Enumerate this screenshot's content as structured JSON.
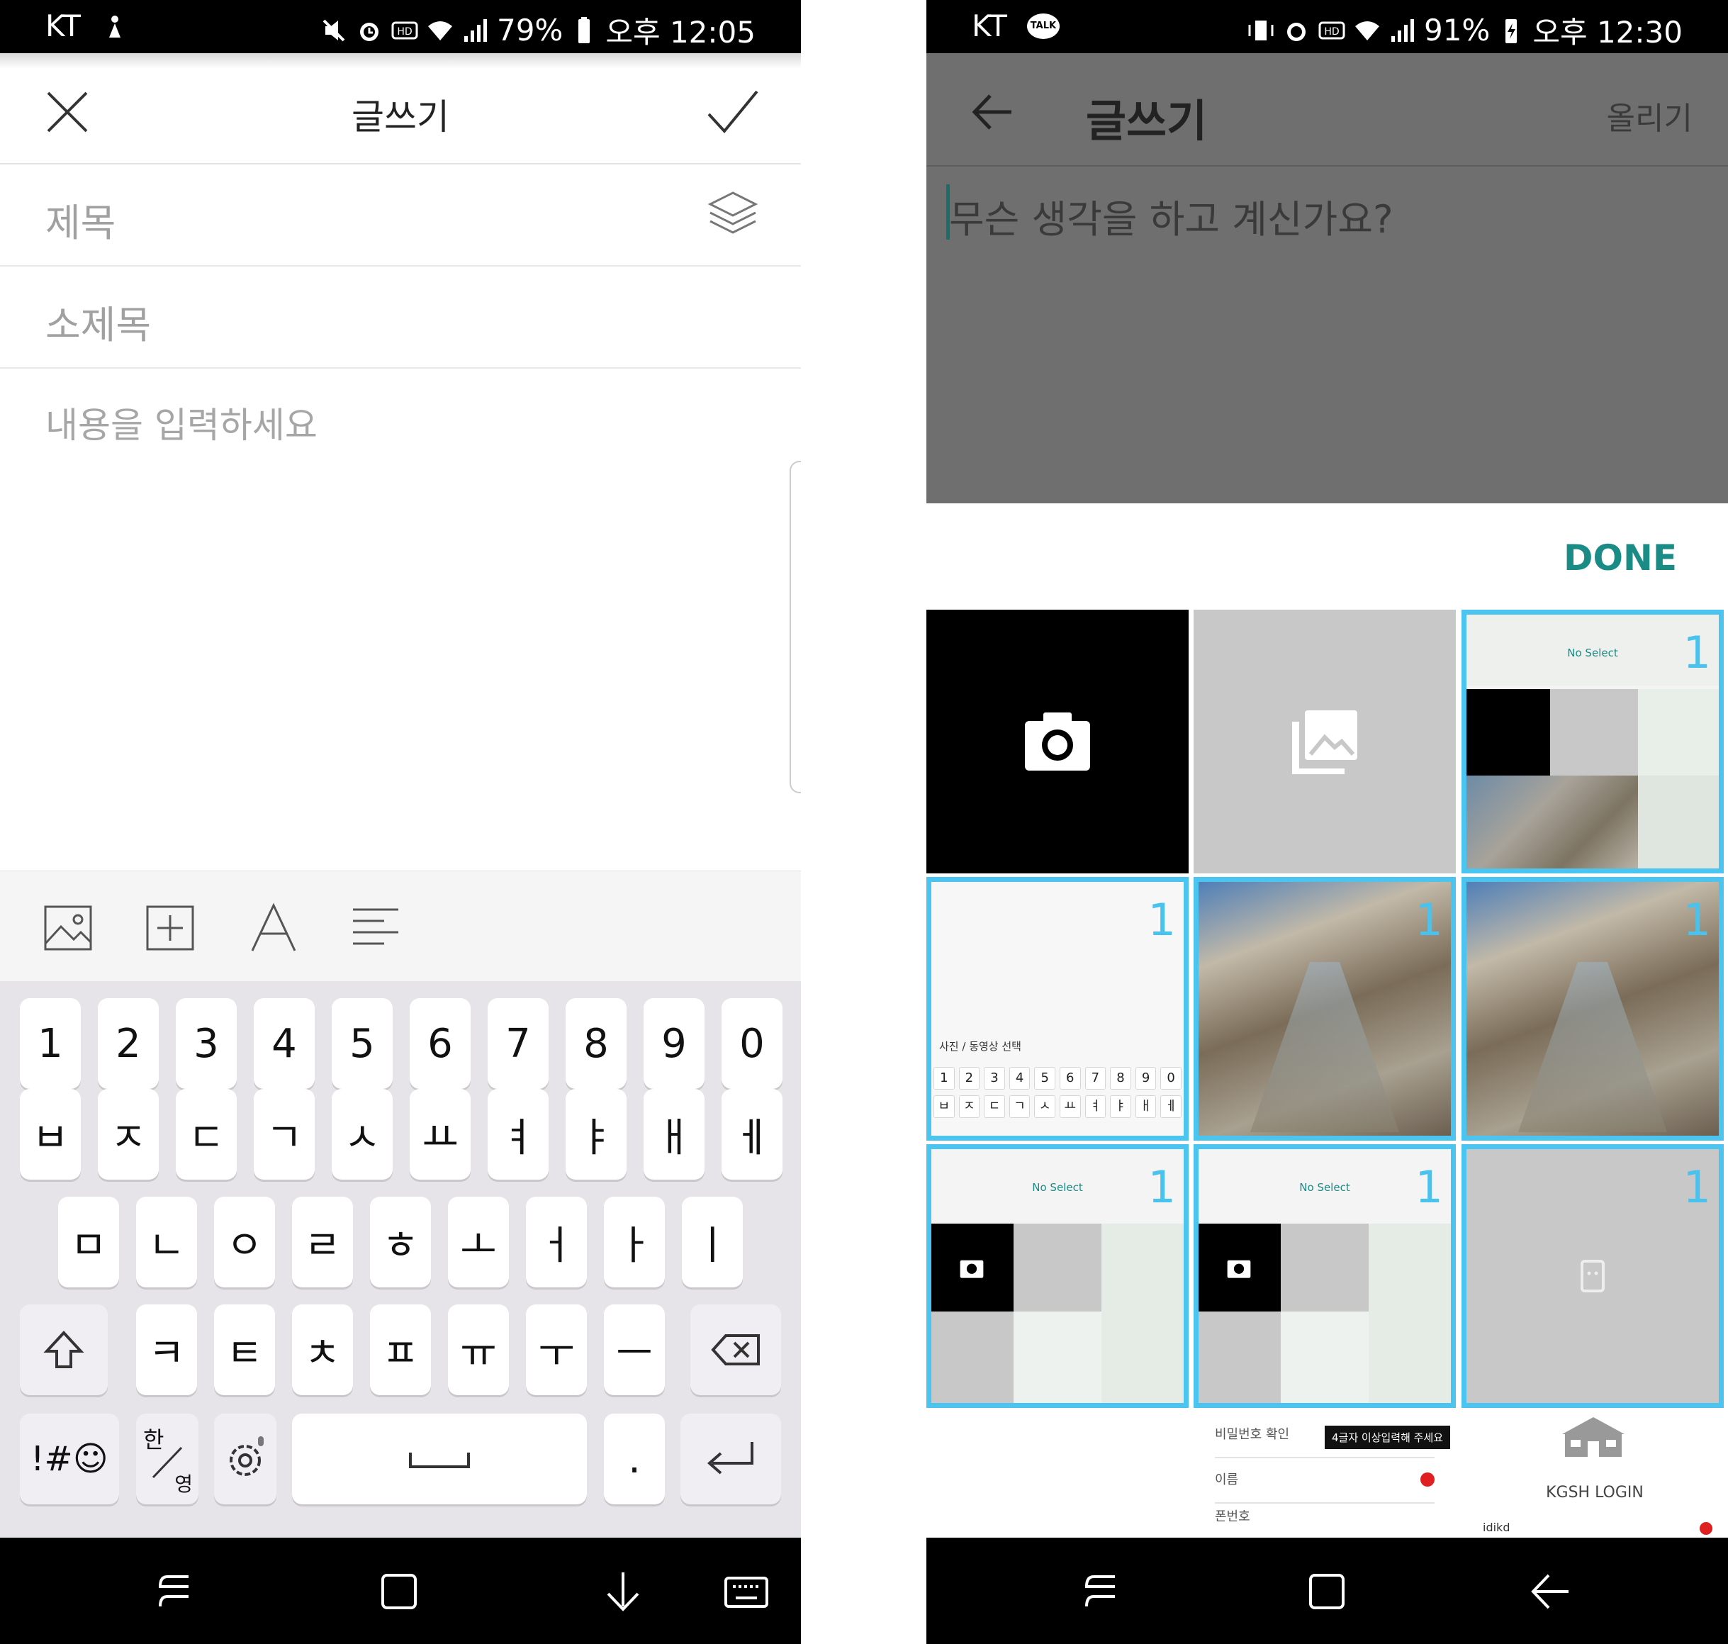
{
  "left": {
    "status": {
      "carrier": "KT",
      "battery": "79%",
      "time": "오후 12:05"
    },
    "header": {
      "title": "글쓰기"
    },
    "fields": {
      "title_placeholder": "제목",
      "subtitle_placeholder": "소제목",
      "body_placeholder": "내용을 입력하세요"
    },
    "toolbar": [
      "image-icon",
      "add-box-icon",
      "font-icon",
      "align-icon"
    ],
    "keyboard": {
      "row1": [
        "1",
        "2",
        "3",
        "4",
        "5",
        "6",
        "7",
        "8",
        "9",
        "0"
      ],
      "row2": [
        "ㅂ",
        "ㅈ",
        "ㄷ",
        "ㄱ",
        "ㅅ",
        "ㅛ",
        "ㅕ",
        "ㅑ",
        "ㅐ",
        "ㅔ"
      ],
      "row3": [
        "ㅁ",
        "ㄴ",
        "ㅇ",
        "ㄹ",
        "ㅎ",
        "ㅗ",
        "ㅓ",
        "ㅏ",
        "ㅣ"
      ],
      "row4": [
        "ㅋ",
        "ㅌ",
        "ㅊ",
        "ㅍ",
        "ㅠ",
        "ㅜ",
        "ㅡ"
      ],
      "symbols": "!#☺",
      "lang_top": "한",
      "lang_bottom": "영",
      "period": "."
    }
  },
  "right": {
    "status": {
      "carrier": "KT",
      "talk": "TALK",
      "battery": "91%",
      "time": "오후 12:30"
    },
    "header": {
      "title": "글쓰기",
      "post_label": "올리기"
    },
    "input_placeholder": "무슨 생각을 하고 계신가요?",
    "done_label": "DONE",
    "thumbnails": {
      "no_select": "No Select",
      "count": "1",
      "photo_select": "사진 / 동영상 선택"
    },
    "partial_row": {
      "password_confirm": "비밀번호 확인",
      "toast": "4글자 이상입력해 주세요",
      "name": "이름",
      "phone": "폰번호",
      "kgsh_login": "KGSH LOGIN",
      "id_value": "idikd"
    }
  },
  "colors": {
    "accent_teal": "#1b8b86",
    "selection_blue": "#4cc4f0",
    "keyboard_bg": "#e6e3e9"
  }
}
